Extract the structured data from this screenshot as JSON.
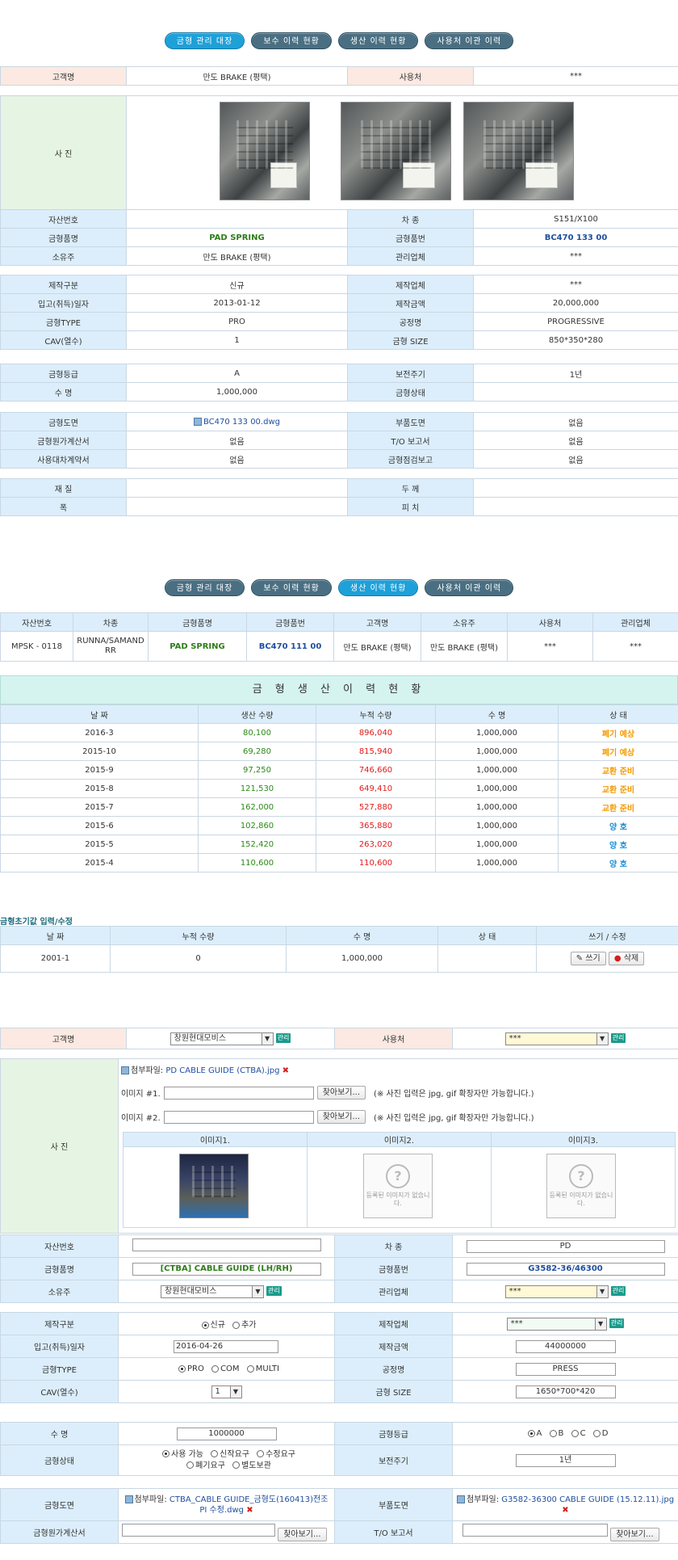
{
  "tabs": [
    "금형 관리 대장",
    "보수 이력 현황",
    "생산 이력 현황",
    "사용처 이관 이력"
  ],
  "sec1": {
    "customer_label": "고객명",
    "customer": "만도 BRAKE (평택)",
    "user_label": "사용처",
    "user": "***",
    "photo_label": "사 진",
    "asset_label": "자산번호",
    "asset": "",
    "car_label": "차 종",
    "car": "S151/X100",
    "product_label": "금형품명",
    "product": "PAD SPRING",
    "part_label": "금형품번",
    "part": "BC470 133 00",
    "owner_label": "소유주",
    "owner": "만도 BRAKE (평택)",
    "mgmt_label": "관리업체",
    "mgmt": "***",
    "make_type_label": "제작구분",
    "make_type": "신규",
    "maker_label": "제작업체",
    "maker": "***",
    "acq_date_label": "입고(취득)일자",
    "acq_date": "2013-01-12",
    "cost_label": "제작금액",
    "cost": "20,000,000",
    "mold_type_label": "금형TYPE",
    "mold_type": "PRO",
    "process_label": "공정명",
    "process": "PROGRESSIVE",
    "cav_label": "CAV(열수)",
    "cav": "1",
    "size_label": "금형 SIZE",
    "size": "850*350*280",
    "grade_label": "금형등급",
    "grade": "A",
    "period_label": "보전주기",
    "period": "1년",
    "life_label": "수 명",
    "life": "1,000,000",
    "status_label": "금형상태",
    "status": "",
    "drawing_label": "금형도면",
    "drawing": "BC470 133 00.dwg",
    "part_drawing_label": "부품도면",
    "part_drawing": "없음",
    "cost_calc_label": "금형원가계산서",
    "cost_calc": "없음",
    "to_report_label": "T/O 보고서",
    "to_report": "없음",
    "loan_label": "사용대차계약서",
    "loan": "없음",
    "inspect_label": "금형점검보고",
    "inspect": "없음",
    "material_label": "재 질",
    "material": "",
    "thickness_label": "두 께",
    "thickness": "",
    "width_label": "폭",
    "width": "",
    "pitch_label": "피 치",
    "pitch": ""
  },
  "sec2": {
    "summary_headers": [
      "자산번호",
      "차종",
      "금형품명",
      "금형품번",
      "고객명",
      "소유주",
      "사용처",
      "관리업체"
    ],
    "summary_row": [
      "MPSK - 0118",
      "RUNNA/SAMAND RR",
      "PAD SPRING",
      "BC470 111 00",
      "만도 BRAKE (평택)",
      "만도 BRAKE (평택)",
      "***",
      "***"
    ],
    "history_title": "금 형 생 산 이 력 현 황",
    "history_headers": [
      "날 짜",
      "생산 수량",
      "누적 수량",
      "수 명",
      "상 태"
    ],
    "history_rows": [
      [
        "2016-3",
        "80,100",
        "896,040",
        "1,000,000",
        "폐기 예상"
      ],
      [
        "2015-10",
        "69,280",
        "815,940",
        "1,000,000",
        "폐기 예상"
      ],
      [
        "2015-9",
        "97,250",
        "746,660",
        "1,000,000",
        "교환 준비"
      ],
      [
        "2015-8",
        "121,530",
        "649,410",
        "1,000,000",
        "교환 준비"
      ],
      [
        "2015-7",
        "162,000",
        "527,880",
        "1,000,000",
        "교환 준비"
      ],
      [
        "2015-6",
        "102,860",
        "365,880",
        "1,000,000",
        "양 호"
      ],
      [
        "2015-5",
        "152,420",
        "263,020",
        "1,000,000",
        "양 호"
      ],
      [
        "2015-4",
        "110,600",
        "110,600",
        "1,000,000",
        "양 호"
      ]
    ],
    "init_title": "금형초기값 입력/수정",
    "init_headers": [
      "날 짜",
      "누적 수량",
      "수 명",
      "상 태",
      "쓰기 / 수정"
    ],
    "init_row": [
      "2001-1",
      "0",
      "1,000,000",
      ""
    ],
    "write_btn": "쓰기",
    "delete_btn": "삭제"
  },
  "sec3": {
    "customer_label": "고객명",
    "customer": "창원현대모비스",
    "mgr_btn": "관리",
    "user_label": "사용처",
    "user": "***",
    "photo_label": "사 진",
    "attach_prefix": "첨부파일:",
    "attach_file": "PD CABLE GUIDE (CTBA).jpg",
    "img_label_1": "이미지 #1.",
    "img_label_2": "이미지 #2.",
    "browse_btn": "찾아보기...",
    "img_hint": "(※ 사진 입력은 jpg, gif 확장자만 가능합니다.)",
    "img_col_headers": [
      "이미지1.",
      "이미지2.",
      "이미지3."
    ],
    "no_img_text": "등록된 이미지가 없습니다.",
    "asset_label": "자산번호",
    "asset": "",
    "car_label": "차 종",
    "car": "PD",
    "product_label": "금형품명",
    "product": "[CTBA] CABLE GUIDE (LH/RH)",
    "part_label": "금형품번",
    "part": "G3582-36/46300",
    "owner_label": "소유주",
    "owner": "창원현대모비스",
    "mgmt_label": "관리업체",
    "mgmt": "***",
    "make_type_label": "제작구분",
    "make_options": [
      "신규",
      "추가"
    ],
    "maker_label": "제작업체",
    "maker": "***",
    "acq_date_label": "입고(취득)일자",
    "acq_date": "2016-04-26",
    "cost_label": "제작금액",
    "cost": "44000000",
    "mold_type_label": "금형TYPE",
    "mold_type_options": [
      "PRO",
      "COM",
      "MULTI"
    ],
    "process_label": "공정명",
    "process": "PRESS",
    "cav_label": "CAV(열수)",
    "cav": "1",
    "size_label": "금형 SIZE",
    "size": "1650*700*420",
    "life_label": "수 명",
    "life": "1000000",
    "grade_label": "금형등급",
    "grade_options": [
      "A",
      "B",
      "C",
      "D"
    ],
    "status_label": "금형상태",
    "status_options_1": [
      "사용 가능",
      "신작요구",
      "수정요구"
    ],
    "status_options_2": [
      "폐기요구",
      "별도보관"
    ],
    "period_label": "보전주기",
    "period": "1년",
    "drawing_label": "금형도면",
    "drawing_file": "CTBA_CABLE GUIDE_금형도(160413)전조 PI 수정.dwg",
    "part_drawing_label": "부품도면",
    "part_drawing_file": "G3582-36300 CABLE GUIDE (15.12.11).jpg",
    "cost_calc_label": "금형원가계산서",
    "to_report_label": "T/O 보고서"
  }
}
